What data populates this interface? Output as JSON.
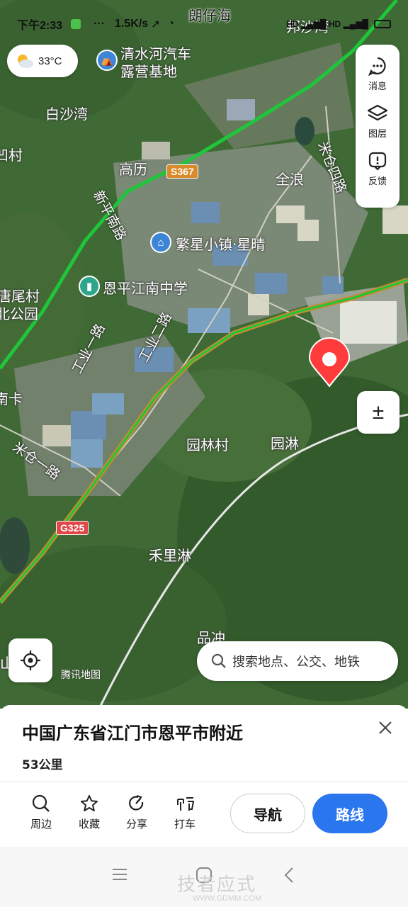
{
  "status_bar": {
    "time": "下午2:33",
    "net_speed": "1.5K/s",
    "icons": [
      "app-icon",
      "more-dots",
      "location-arrow",
      "alarm",
      "hd",
      "signal",
      "hd",
      "signal-4g",
      "battery"
    ]
  },
  "weather": {
    "temperature": "33°C",
    "icon": "partly-cloudy-icon"
  },
  "tools": {
    "message_label": "消息",
    "layers_label": "图层",
    "feedback_label": "反馈"
  },
  "zoom": {
    "label": "±"
  },
  "map": {
    "places": {
      "p1": "朗仔海",
      "p2": "邦沙湾",
      "p3": "白沙湾",
      "p4": "凹村",
      "p5": "高历",
      "p6": "全浪",
      "p7": "唐尾村",
      "p8": "北公园",
      "p9": "南卡",
      "p10": "园林村",
      "p11": "园淋",
      "p12": "禾里淋",
      "p13": "品冲",
      "p14": "山"
    },
    "pois": {
      "camp": "清水河汽车",
      "camp2": "露营基地",
      "town": "繁星小镇·星晴",
      "school": "恩平江南中学"
    },
    "roads": {
      "r1": "新平南路",
      "r2": "米仓四路",
      "r3": "工业一路",
      "r4": "工业二路",
      "r5": "米仓一路"
    },
    "shields": {
      "s367": "S367",
      "g325": "G325"
    },
    "brand": "腾讯地图",
    "colors": {
      "highway": "#1fc63a",
      "road_orange": "#c88a30",
      "pin": "#ff3b3b"
    }
  },
  "search": {
    "placeholder": "搜索地点、公交、地铁"
  },
  "sheet": {
    "title": "中国广东省江门市恩平市附近",
    "distance": "53公里",
    "actions": [
      {
        "label": "周边",
        "icon": "search-icon"
      },
      {
        "label": "收藏",
        "icon": "star-icon"
      },
      {
        "label": "分享",
        "icon": "share-icon"
      },
      {
        "label": "打车",
        "icon": "taxi-icon"
      }
    ],
    "nav_label": "导航",
    "route_label": "路线"
  },
  "watermark": {
    "text": "技者应式",
    "url": "WWW.GDMM.COM"
  }
}
